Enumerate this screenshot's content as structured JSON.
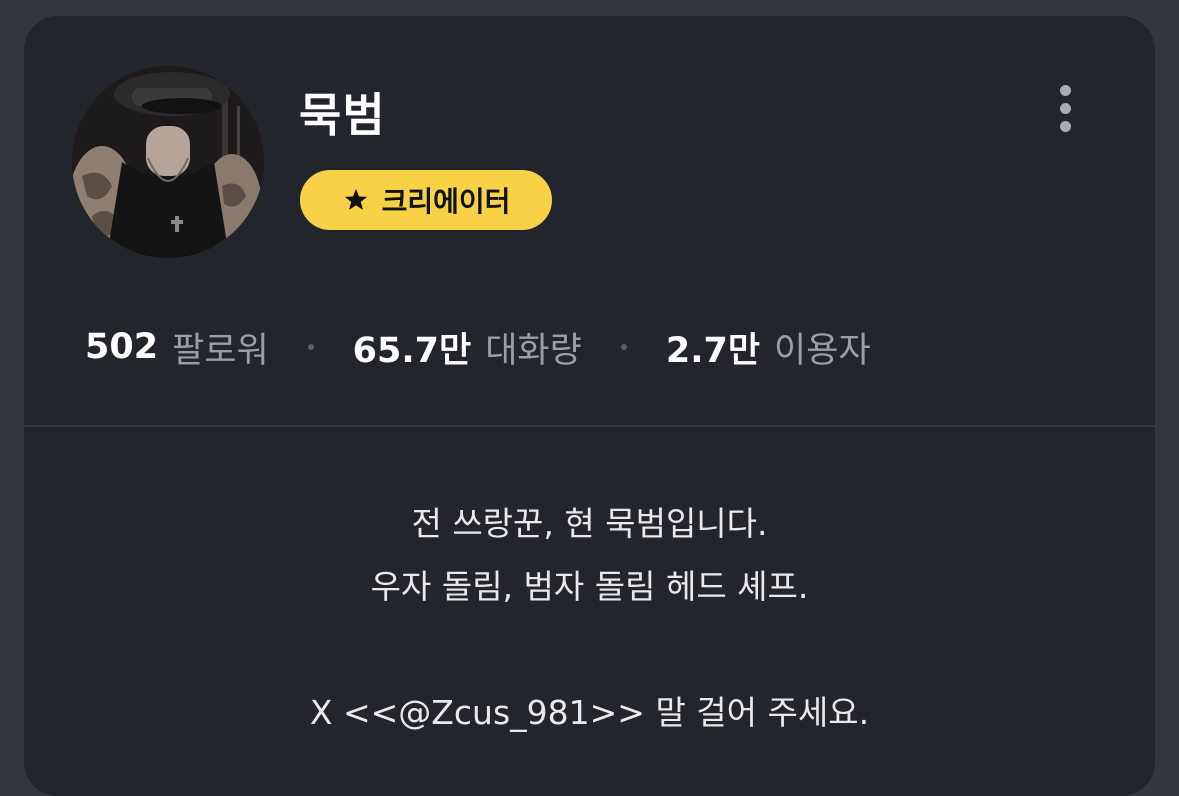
{
  "profile": {
    "name": "묵범",
    "badge_label": "크리에이터",
    "badge_icon": "star-icon",
    "badge_color": "#f7d146",
    "avatar_icon": "profile-photo-avatar",
    "menu_icon": "more-vertical-icon"
  },
  "stats": [
    {
      "value": "502",
      "label": "팔로워"
    },
    {
      "value": "65.7만",
      "label": "대화량"
    },
    {
      "value": "2.7만",
      "label": "이용자"
    }
  ],
  "bio": {
    "line1": "전 쓰랑꾼, 현 묵범입니다.",
    "line2": "우자 돌림, 범자 돌림 헤드 셰프.",
    "line3": "X <<@Zcus_981>> 말 걸어 주세요."
  }
}
